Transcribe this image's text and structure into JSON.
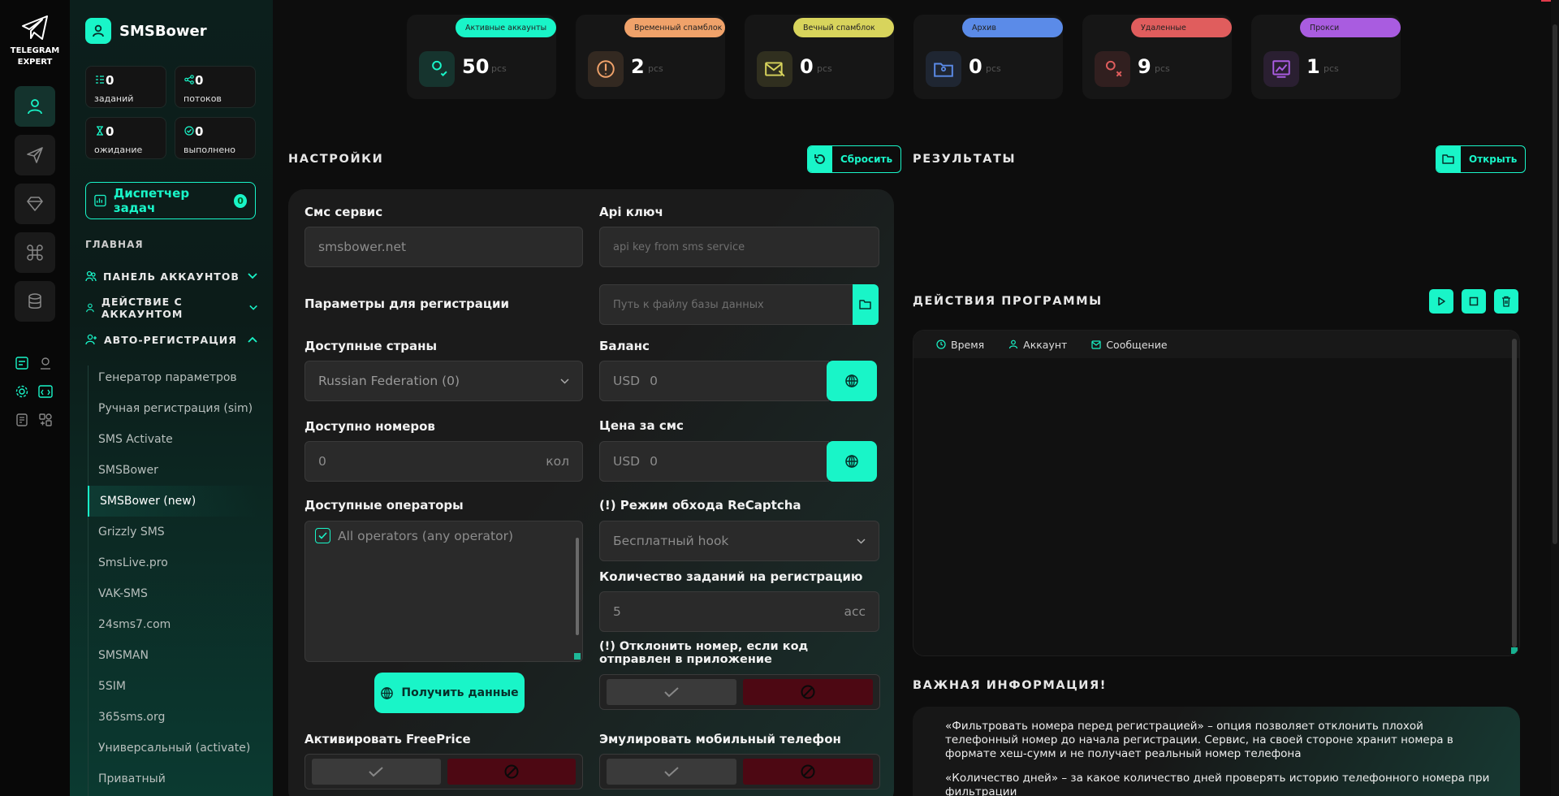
{
  "rail": {
    "logo_line1": "TELEGRAM",
    "logo_line2": "EXPERT",
    "nav_icons": [
      "user-icon",
      "send-icon",
      "diamond-icon",
      "command-icon",
      "database-icon"
    ]
  },
  "sidebar": {
    "brand": "SMSBower",
    "stats": [
      {
        "value": "0",
        "label": "заданий"
      },
      {
        "value": "0",
        "label": "потоков"
      },
      {
        "value": "0",
        "label": "ожидание"
      },
      {
        "value": "0",
        "label": "выполнено"
      }
    ],
    "dispatcher": {
      "label": "Диспетчер задач",
      "count": "0"
    },
    "section": "ГЛАВНАЯ",
    "groups": [
      {
        "label": "ПАНЕЛЬ АККАУНТОВ"
      },
      {
        "label": "ДЕЙСТВИЕ С АККАУНТОМ"
      },
      {
        "label": "АВТО-РЕГИСТРАЦИЯ"
      }
    ],
    "sub_items": [
      "Генератор параметров",
      "Ручная регистрация (sim)",
      "SMS Activate",
      "SMSBower",
      "SMSBower (new)",
      "Grizzly SMS",
      "SmsLive.pro",
      "VAK-SMS",
      "24sms7.com",
      "SMSMAN",
      "5SIM",
      "365sms.org",
      "Универсальный (activate)",
      "Приватный"
    ],
    "selected_index": 4
  },
  "status_cards": [
    {
      "badge": "Активные аккаунты",
      "value": "50",
      "unit": "pcs",
      "badge_color": "#19f5c8",
      "icon_color": "#19f5c8"
    },
    {
      "badge": "Временный спамблок",
      "value": "2",
      "unit": "pcs",
      "badge_color": "#f0a26a",
      "icon_color": "#f0a26a"
    },
    {
      "badge": "Вечный спамблок",
      "value": "0",
      "unit": "pcs",
      "badge_color": "#d8d45c",
      "icon_color": "#d8d45c"
    },
    {
      "badge": "Архив",
      "value": "0",
      "unit": "pcs",
      "badge_color": "#5b8be8",
      "icon_color": "#5b8be8"
    },
    {
      "badge": "Удаленные",
      "value": "9",
      "unit": "pcs",
      "badge_color": "#e05d5d",
      "icon_color": "#e05d5d"
    },
    {
      "badge": "Прокси",
      "value": "1",
      "unit": "pcs",
      "badge_color": "#a95ce0",
      "icon_color": "#a95ce0"
    }
  ],
  "settings": {
    "title": "НАСТРОЙКИ",
    "reset_label": "Сбросить",
    "sms_service_label": "Смс сервис",
    "sms_service_value": "smsbower.net",
    "api_key_label": "Api ключ",
    "api_key_placeholder": "api key from sms service",
    "reg_params_label": "Параметры для регистрации",
    "db_path_placeholder": "Путь к файлу базы данных",
    "countries_label": "Доступные страны",
    "country_value": "Russian Federation (0)",
    "balance_label": "Баланс",
    "balance_currency": "USD",
    "balance_value": "0",
    "numbers_label": "Доступно номеров",
    "numbers_value": "0",
    "numbers_unit": "кол",
    "price_label": "Цена за смс",
    "price_currency": "USD",
    "price_value": "0",
    "operators_label": "Доступные операторы",
    "operator_item": "All operators (any operator)",
    "recaptcha_label": "(!) Режим обхода ReCaptcha",
    "recaptcha_value": "Бесплатный hook",
    "tasks_label": "Количество заданий на регистрацию",
    "tasks_value": "5",
    "tasks_unit": "acc",
    "reject_label": "(!) Отклонить номер, если код отправлен в приложение",
    "get_data_label": "Получить данные",
    "freeprice_label": "Активировать FreePrice",
    "emulate_label": "Эмулировать мобильный телефон"
  },
  "results": {
    "title": "РЕЗУЛЬТАТЫ",
    "open_label": "Открыть"
  },
  "actions": {
    "title": "ДЕЙСТВИЯ ПРОГРАММЫ",
    "col_time": "Время",
    "col_account": "Аккаунт",
    "col_message": "Сообщение"
  },
  "info": {
    "title": "ВАЖНАЯ ИНФОРМАЦИЯ!",
    "p1": "«Фильтровать номера перед регистрацией» – опция позволяет отклонить плохой телефонный номер до начала регистрации. Сервис, на своей стороне хранит номера в формате хеш-сумм и не получает реальный номер телефона",
    "p2": "«Количество дней» – за какое количество дней проверять историю телефонного номера при фильтрации"
  },
  "colors": {
    "accent": "#19f5c8",
    "reject": "#4d0813"
  }
}
